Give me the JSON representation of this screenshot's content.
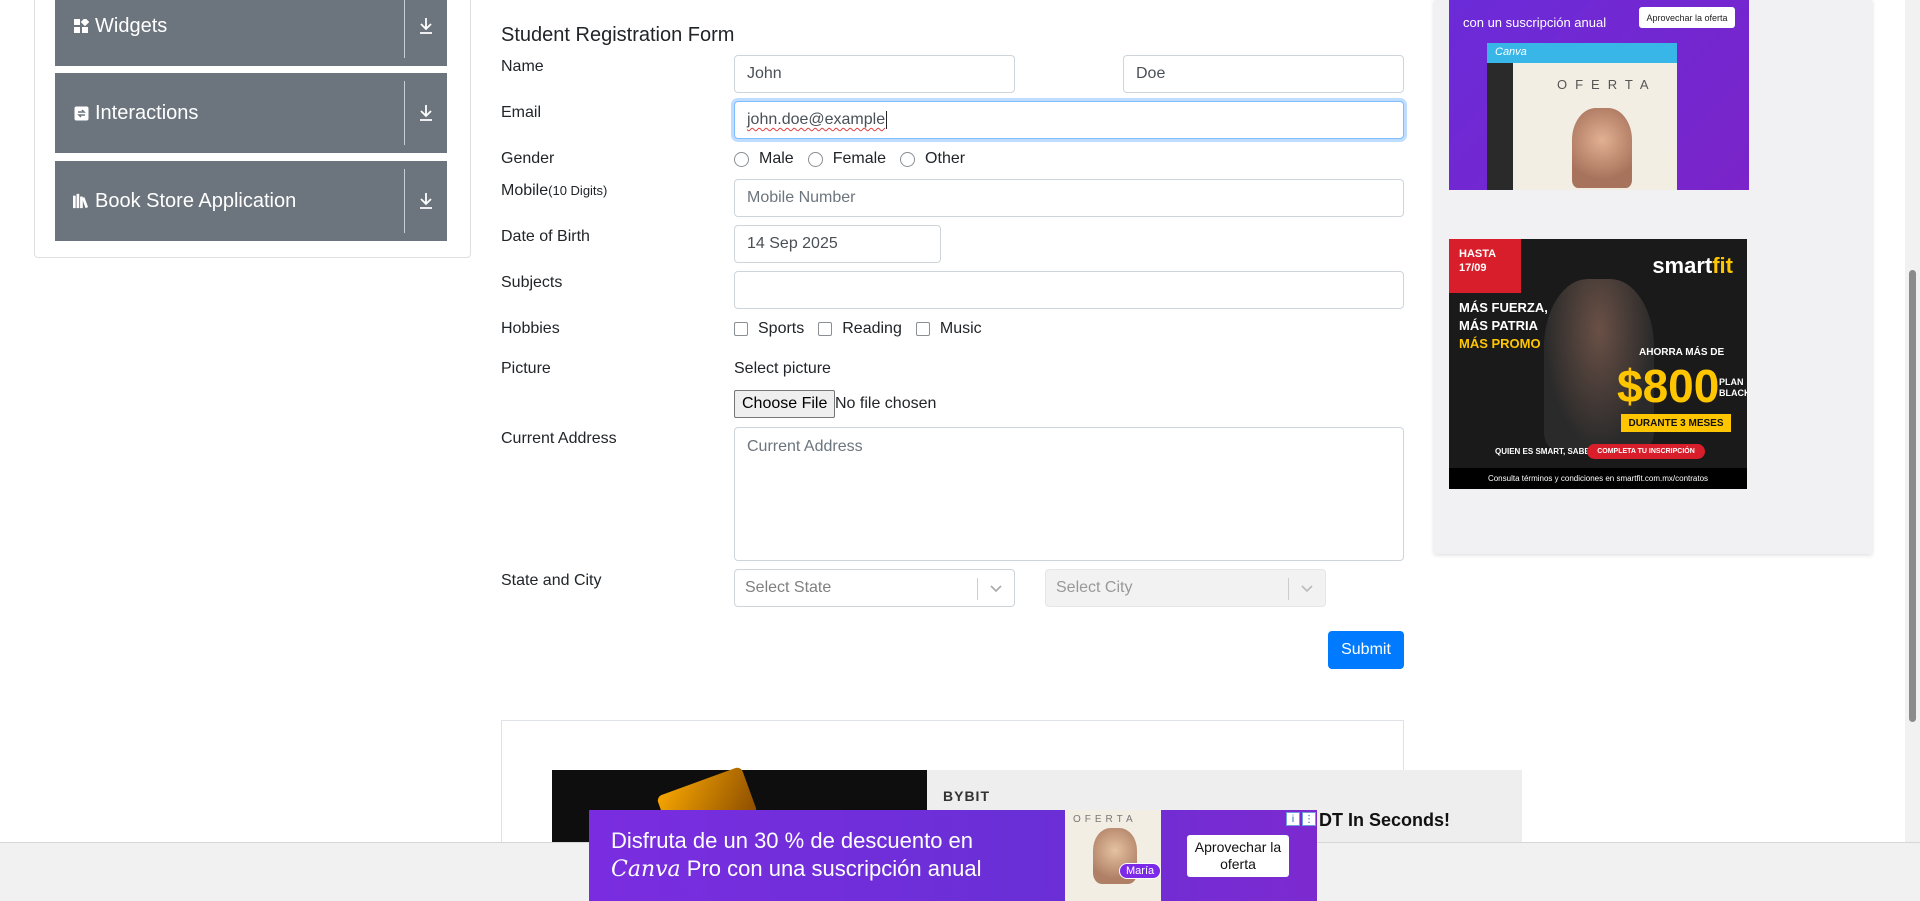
{
  "sidebar": {
    "groups": [
      {
        "label": "Widgets",
        "icon": "widgets-icon"
      },
      {
        "label": "Interactions",
        "icon": "interactions-icon"
      },
      {
        "label": "Book Store Application",
        "icon": "book-icon"
      }
    ]
  },
  "form": {
    "title": "Student Registration Form",
    "name_label": "Name",
    "first_name": "John",
    "last_name": "Doe",
    "email_label": "Email",
    "email_value": "john.doe@example",
    "gender_label": "Gender",
    "gender_options": [
      "Male",
      "Female",
      "Other"
    ],
    "mobile_label": "Mobile",
    "mobile_hint": "(10 Digits)",
    "mobile_placeholder": "Mobile Number",
    "dob_label": "Date of Birth",
    "dob_value": "14 Sep 2025",
    "subjects_label": "Subjects",
    "hobbies_label": "Hobbies",
    "hobby_options": [
      "Sports",
      "Reading",
      "Music"
    ],
    "picture_label": "Picture",
    "picture_prompt": "Select picture",
    "choose_file": "Choose File",
    "no_file": "No file chosen",
    "address_label": "Current Address",
    "address_placeholder": "Current Address",
    "state_city_label": "State and City",
    "state_placeholder": "Select State",
    "city_placeholder": "Select City",
    "submit": "Submit"
  },
  "ads": {
    "canva_top": {
      "tagline": "con un suscripción anual",
      "button": "Aprovechar la oferta",
      "brand": "Canva",
      "oferta": "OFERTA"
    },
    "smartfit": {
      "hasta": "HASTA",
      "date": "17/09",
      "logo_a": "smart",
      "logo_b": "fit",
      "claim1": "MÁS FUERZA,",
      "claim2": "MÁS PATRIA",
      "claim3": "MÁS PROMO",
      "ahorra": "AHORRA MÁS DE",
      "amount": "$800",
      "plan": "PLAN BLACK",
      "durante": "DURANTE 3 MESES",
      "quien": "QUIEN ES SMART, SABE.",
      "completa": "COMPLETA TU INSCRIPCIÓN",
      "terms": "Consulta términos y condiciones en smartfit.com.mx/contratos"
    },
    "bybit": {
      "logo": "BYBIT",
      "headline": "DT In Seconds!"
    },
    "canva_bottom": {
      "line1": "Disfruta de un 30 % de descuento en",
      "brand": "Canva",
      "line2_rest": " Pro con una suscripción anual",
      "oferta": "OFERTA",
      "maria": "María",
      "cta": "Aprovechar la oferta"
    }
  },
  "colors": {
    "sidebar_header": "#6c757d",
    "primary": "#007bff",
    "canva_purple": "#7a2de0",
    "smartfit_yellow": "#ffc600",
    "smartfit_red": "#d81e2b"
  }
}
